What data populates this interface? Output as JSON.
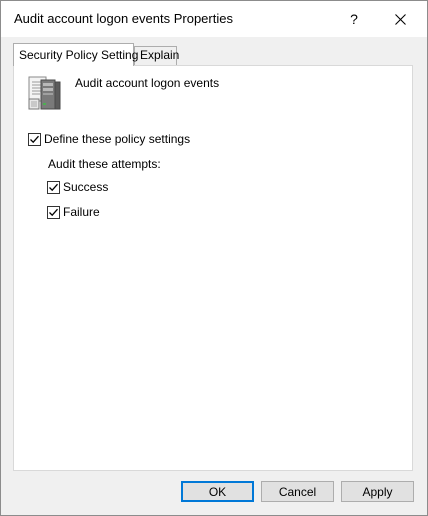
{
  "window": {
    "title": "Audit account logon events Properties",
    "help_label": "?"
  },
  "tabs": [
    {
      "label": "Security Policy Setting",
      "active": true
    },
    {
      "label": "Explain",
      "active": false
    }
  ],
  "policy": {
    "name": "Audit account logon events",
    "icon": "server-policy-icon"
  },
  "settings": {
    "define_label": "Define these policy settings",
    "define_checked": true,
    "audit_label": "Audit these attempts:",
    "success_label": "Success",
    "success_checked": true,
    "failure_label": "Failure",
    "failure_checked": true
  },
  "buttons": {
    "ok": "OK",
    "cancel": "Cancel",
    "apply": "Apply"
  },
  "colors": {
    "accent": "#0078d7",
    "face": "#f0f0f0"
  }
}
